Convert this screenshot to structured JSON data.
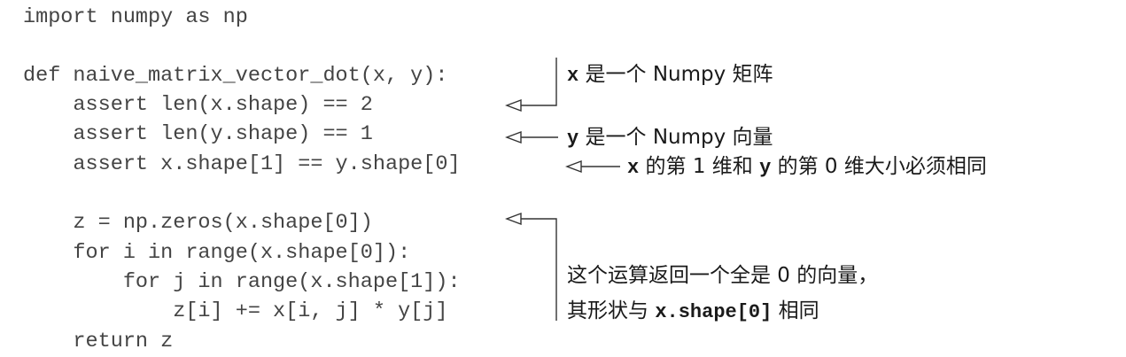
{
  "code": {
    "lines": [
      "import numpy as np",
      "",
      "def naive_matrix_vector_dot(x, y):",
      "    assert len(x.shape) == 2",
      "    assert len(y.shape) == 1",
      "    assert x.shape[1] == y.shape[0]",
      "",
      "    z = np.zeros(x.shape[0])",
      "    for i in range(x.shape[0]):",
      "        for j in range(x.shape[1]):",
      "            z[i] += x[i, j] * y[j]",
      "    return z"
    ]
  },
  "annotations": {
    "a1": {
      "code": "x",
      "text": "是一个 Numpy 矩阵"
    },
    "a2": {
      "code": "y",
      "text": "是一个 Numpy 向量"
    },
    "a3": {
      "code1": "x",
      "text1": "的第 1 维和",
      "code2": "y",
      "text2": "的第 0 维大小必须相同"
    },
    "a4": {
      "line1": "这个运算返回一个全是 0 的向量，",
      "line2_text1": "其形状与",
      "line2_code": "x.shape[0]",
      "line2_text2": "相同"
    }
  }
}
